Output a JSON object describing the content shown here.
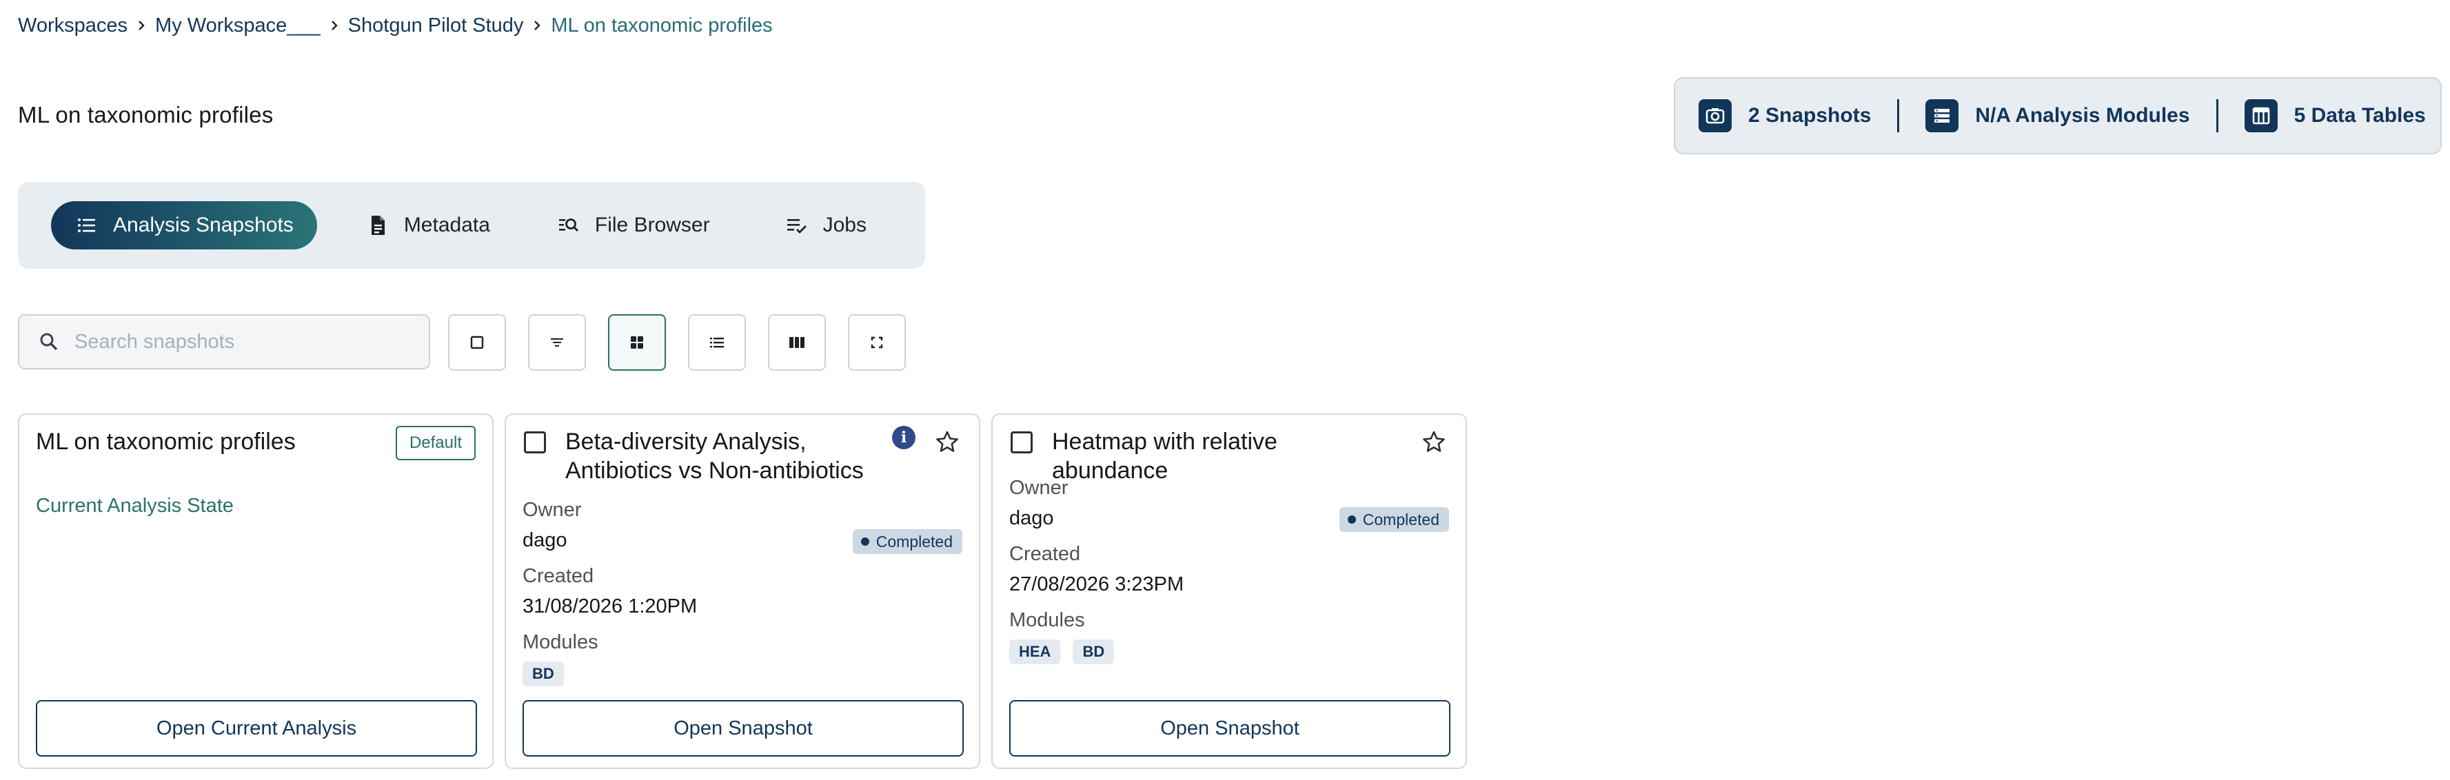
{
  "breadcrumb": [
    {
      "label": "Workspaces"
    },
    {
      "label": "My Workspace___"
    },
    {
      "label": "Shotgun Pilot Study"
    },
    {
      "label": "ML on taxonomic profiles"
    }
  ],
  "page_title": "ML on taxonomic profiles",
  "stats": {
    "snapshots": "2 Snapshots",
    "modules": "N/A Analysis Modules",
    "tables": "5 Data Tables"
  },
  "tabs": [
    {
      "label": "Analysis Snapshots",
      "icon": "list-icon",
      "active": true
    },
    {
      "label": "Metadata",
      "icon": "document-icon",
      "active": false
    },
    {
      "label": "File Browser",
      "icon": "file-search-icon",
      "active": false
    },
    {
      "label": "Jobs",
      "icon": "jobs-check-icon",
      "active": false
    }
  ],
  "search": {
    "placeholder": "Search snapshots",
    "value": ""
  },
  "toolbar": [
    "select-all-checkbox-icon",
    "filter-icon",
    "grid-view-icon",
    "list-view-icon",
    "column-view-icon",
    "fullscreen-icon"
  ],
  "cards": {
    "current": {
      "title": "ML on taxonomic profiles",
      "badge": "Default",
      "link": "Current Analysis State",
      "button": "Open Current Analysis"
    },
    "snapshot1": {
      "title": "Beta-diversity Analysis, Antibiotics vs Non-antibiotics",
      "owner_label": "Owner",
      "owner": "dago",
      "status": "Completed",
      "created_label": "Created",
      "created": "31/08/2026 1:20PM",
      "modules_label": "Modules",
      "modules": [
        "BD"
      ],
      "button": "Open Snapshot"
    },
    "snapshot2": {
      "title": "Heatmap with relative abundance",
      "owner_label": "Owner",
      "owner": "dago",
      "status": "Completed",
      "created_label": "Created",
      "created": "27/08/2026 3:23PM",
      "modules_label": "Modules",
      "modules": [
        "HEA",
        "BD"
      ],
      "button": "Open Snapshot"
    }
  },
  "colors": {
    "primary": "#12365a",
    "accent": "#2a7478",
    "panel": "#e8edf1",
    "status_badge": "#cdd8e4"
  }
}
